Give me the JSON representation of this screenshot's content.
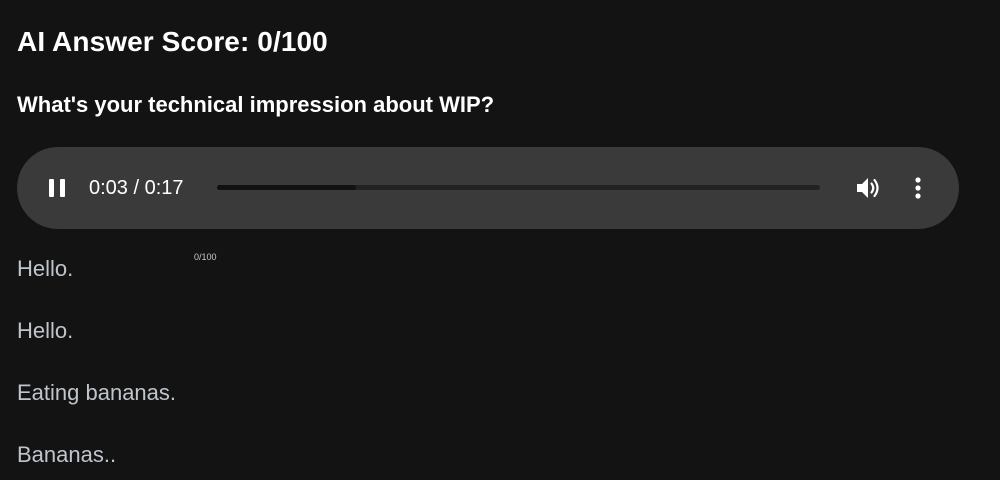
{
  "header": {
    "score_title": "AI Answer Score: 0/100",
    "question": "What's your technical impression about WIP?"
  },
  "audio_player": {
    "state": "playing",
    "current_time": "0:03",
    "duration": "0:17",
    "time_display": "0:03 / 0:17",
    "progress_fraction": 0.23,
    "pause_icon": "pause-icon",
    "volume_icon": "volume-icon",
    "menu_icon": "more-vertical-icon"
  },
  "mini_score": "0/100",
  "transcript": [
    "Hello.",
    "Hello.",
    "Eating bananas.",
    "Bananas.."
  ],
  "colors": {
    "background": "#131313",
    "player_background": "#3a3a3a",
    "text_primary": "#ffffff",
    "text_secondary": "#bfc5cc"
  }
}
